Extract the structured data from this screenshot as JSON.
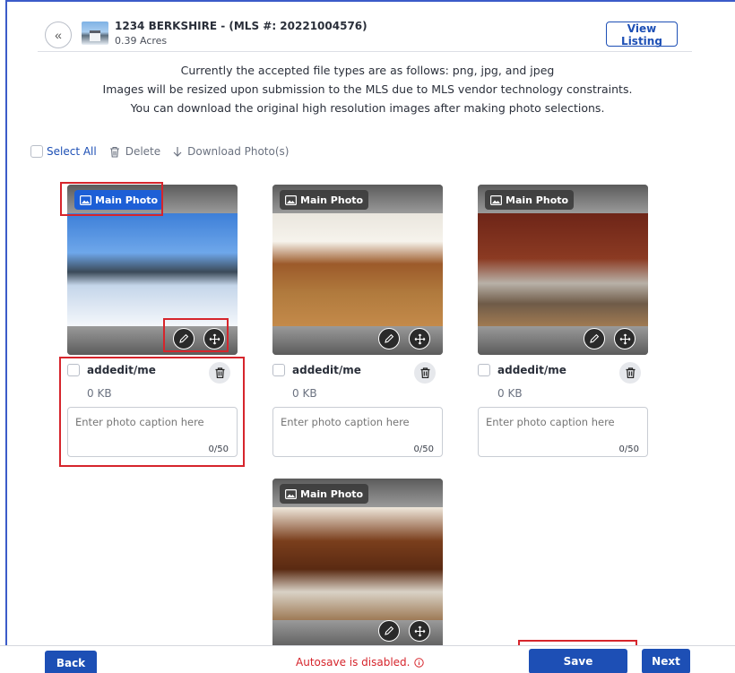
{
  "colors": {
    "accent": "#1d4fb5",
    "badge_active": "#1d5fd6",
    "highlight": "#d6252c",
    "warning": "#d6252c"
  },
  "header": {
    "back_glyph": "«",
    "listing_title": "1234 BERKSHIRE - (MLS #: 20221004576)",
    "listing_acres": "0.39 Acres",
    "view_listing_label": "View Listing"
  },
  "notice": {
    "line1": "Currently the accepted file types are as follows: png, jpg, and jpeg",
    "line2": "Images will be resized upon submission to the MLS due to MLS vendor technology constraints.",
    "line3": "You can download the original high resolution images after making photo selections."
  },
  "toolbar": {
    "select_all": "Select All",
    "delete": "Delete",
    "download": "Download Photo(s)"
  },
  "photos": [
    {
      "badge": "Main Photo",
      "badge_active": true,
      "file": "addedit/me",
      "size": "0 KB",
      "caption_placeholder": "Enter photo caption here",
      "caption_count": "0/50"
    },
    {
      "badge": "Main Photo",
      "badge_active": false,
      "file": "addedit/me",
      "size": "0 KB",
      "caption_placeholder": "Enter photo caption here",
      "caption_count": "0/50"
    },
    {
      "badge": "Main Photo",
      "badge_active": false,
      "file": "addedit/me",
      "size": "0 KB",
      "caption_placeholder": "Enter photo caption here",
      "caption_count": "0/50"
    },
    {
      "badge": "Main Photo",
      "badge_active": false
    }
  ],
  "footer": {
    "back_label": "Back",
    "autosave_text": "Autosave is disabled.",
    "save_label": "Save",
    "next_label": "Next"
  }
}
